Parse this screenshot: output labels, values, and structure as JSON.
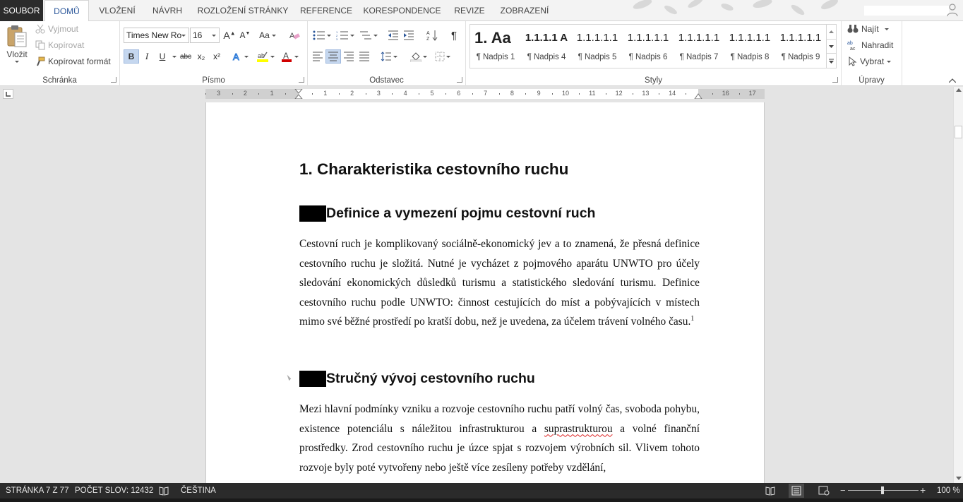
{
  "tabs": {
    "file": "SOUBOR",
    "items": [
      "DOMŮ",
      "VLOŽENÍ",
      "NÁVRH",
      "ROZLOŽENÍ STRÁNKY",
      "REFERENCE",
      "KORESPONDENCE",
      "REVIZE",
      "ZOBRAZENÍ"
    ],
    "active": "DOMŮ"
  },
  "ribbon": {
    "clipboard": {
      "label": "Schránka",
      "paste": "Vložit",
      "cut": "Vyjmout",
      "copy": "Kopírovat",
      "format_painter": "Kopírovat formát"
    },
    "font": {
      "label": "Písmo",
      "font_name": "Times New Ro",
      "font_size": "16",
      "change_case": "Aa",
      "bold": "B",
      "italic": "I",
      "underline": "U",
      "strikethrough": "abc",
      "subscript": "x₂",
      "superscript": "x²"
    },
    "paragraph": {
      "label": "Odstavec"
    },
    "styles": {
      "label": "Styly",
      "items": [
        {
          "preview": "1.  Aa",
          "name": "¶ Nadpis 1"
        },
        {
          "preview": "1.1.1.1 A",
          "name": "¶ Nadpis 4"
        },
        {
          "preview": "1.1.1.1.1",
          "name": "¶ Nadpis 5"
        },
        {
          "preview": "1.1.1.1.1",
          "name": "¶ Nadpis 6"
        },
        {
          "preview": "1.1.1.1.1",
          "name": "¶ Nadpis 7"
        },
        {
          "preview": "1.1.1.1.1",
          "name": "¶ Nadpis 8"
        },
        {
          "preview": "1.1.1.1.1",
          "name": "¶ Nadpis 9"
        }
      ]
    },
    "editing": {
      "label": "Úpravy",
      "find": "Najít",
      "replace": "Nahradit",
      "select": "Vybrat"
    }
  },
  "ruler": {
    "numbers": [
      "3",
      "2",
      "1",
      "1",
      "2",
      "3",
      "4",
      "5",
      "6",
      "7",
      "8",
      "9",
      "10",
      "11",
      "12",
      "13",
      "14",
      "16",
      "17"
    ]
  },
  "document": {
    "heading1": "1.  Charakteristika cestovního ruchu",
    "section1": {
      "heading": "Definice a vymezení pojmu cestovní ruch",
      "paragraph": "Cestovní ruch je komplikovaný sociálně-ekonomický jev a to znamená, že přesná definice cestovního ruchu je složitá. Nutné je vycházet z pojmového aparátu UNWTO pro účely sledování ekonomických důsledků turismu a statistického sledování turismu. Definice cestovního ruchu podle UNWTO: činnost cestujících do míst a pobývajících v místech mimo své běžné prostředí po kratší dobu, než je uvedena, za účelem trávení volného času.",
      "footnote": "1"
    },
    "section2": {
      "heading": "Stručný vývoj cestovního ruchu",
      "paragraph_before": "Mezi hlavní podmínky vzniku a rozvoje cestovního ruchu patří volný čas, svoboda pohybu, existence potenciálu s náležitou infrastrukturou a ",
      "misspelled": "suprastrukturou",
      "paragraph_after": " a volné finanční prostředky. Zrod cestovního ruchu je úzce spjat s rozvojem výrobních sil. Vlivem tohoto rozvoje byly poté vytvořeny nebo ještě více zesíleny potřeby vzdělání,"
    }
  },
  "statusbar": {
    "page": "STRÁNKA 7 Z 77",
    "words": "POČET SLOV: 12432",
    "language": "ČEŠTINA",
    "zoom": "100 %",
    "zoom_level_percent": 100
  },
  "colors": {
    "accent": "#2b579a",
    "file_tab": "#2b2b2b",
    "statusbar": "#2b2b2b",
    "selected_button": "#c5d7ef",
    "font_color_red": "#d00000",
    "highlight_yellow": "#ffff00"
  }
}
